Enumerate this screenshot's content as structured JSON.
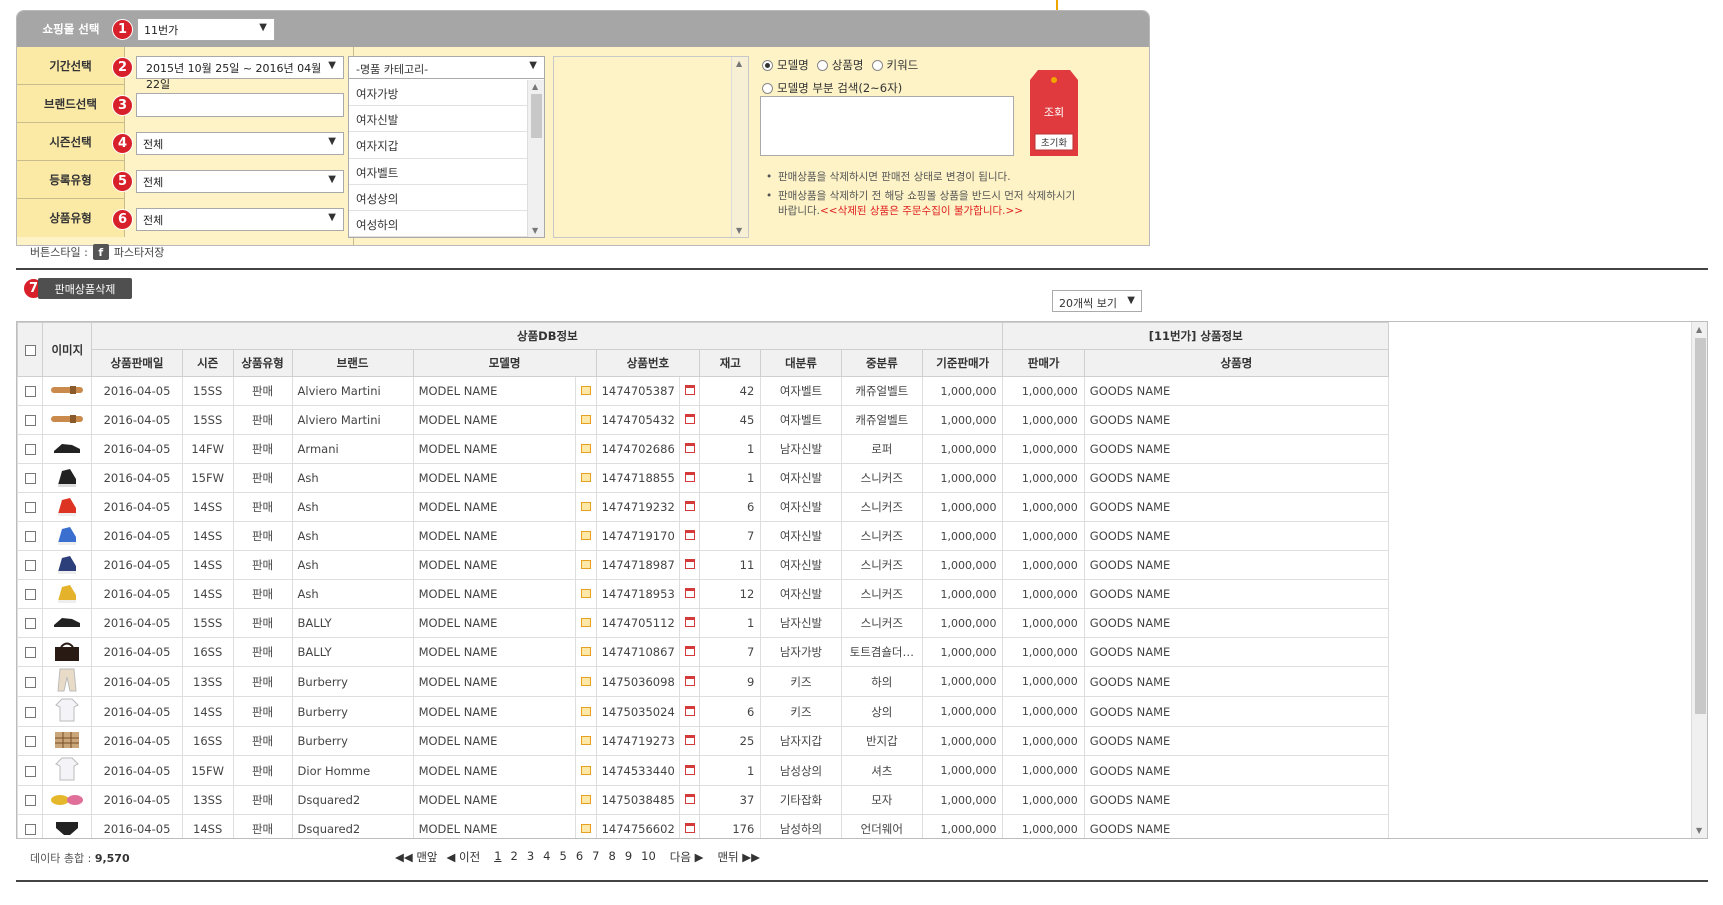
{
  "search": {
    "mall_label": "쇼핑몰 선택",
    "mall_value": "11번가",
    "period_label": "기간선택",
    "period_value": "2015년 10월 25일 ~ 2016년 04월 22일",
    "brand_label": "브랜드선택",
    "season_label": "시즌선택",
    "season_value": "전체",
    "reg_label": "등록유형",
    "reg_value": "전체",
    "ptype_label": "상품유형",
    "ptype_value": "전체",
    "category_select": "-명품 카테고리-",
    "categories": [
      "여자가방",
      "여자신발",
      "여자지갑",
      "여자벨트",
      "여성상의",
      "여성하의"
    ],
    "radio_model": "모델명",
    "radio_product": "상품명",
    "radio_keyword": "키워드",
    "radio_partial": "모델명 부분 검색(2~6자)",
    "note1": "판매상품을 삭제하시면 판매전 상태로 변경이 됩니다.",
    "note2a": "판매상품을 삭제하기 전 해당 쇼핑몰 상품을 반드시 먼저 삭제하시기",
    "note2b": "바랍니다.",
    "note2c": "<<삭제된 상품은 주문수집이 불가합니다.>>",
    "search_btn": "조회",
    "reset_btn": "초기화",
    "badges": [
      "1",
      "2",
      "3",
      "4",
      "5",
      "6",
      "7"
    ]
  },
  "toolbar": {
    "button_style_label": "버튼스타일 :",
    "fb_icon": "f",
    "fb_label": "파스타저장",
    "delete_btn": "판매상품삭제",
    "view_select": "20개씩 보기"
  },
  "table": {
    "group_db": "상품DB정보",
    "group_11st": "[11번가] 상품정보",
    "col_image": "이미지",
    "columns": [
      "상품판매일",
      "시즌",
      "상품유형",
      "브랜드",
      "모델명",
      "상품번호",
      "재고",
      "대분류",
      "중분류",
      "기준판매가",
      "판매가",
      "상품명"
    ],
    "rows": [
      {
        "date": "2016-04-05",
        "season": "15SS",
        "type": "판매",
        "brand": "Alviero Martini",
        "model": "MODEL NAME",
        "no": "1474705387",
        "stock": "42",
        "cat1": "여자벨트",
        "cat2": "캐쥬얼벨트",
        "base": "1,000,000",
        "price": "1,000,000",
        "name": "GOODS NAME",
        "img": "belt-tan"
      },
      {
        "date": "2016-04-05",
        "season": "15SS",
        "type": "판매",
        "brand": "Alviero Martini",
        "model": "MODEL NAME",
        "no": "1474705432",
        "stock": "45",
        "cat1": "여자벨트",
        "cat2": "캐쥬얼벨트",
        "base": "1,000,000",
        "price": "1,000,000",
        "name": "GOODS NAME",
        "img": "belt-tan"
      },
      {
        "date": "2016-04-05",
        "season": "14FW",
        "type": "판매",
        "brand": "Armani",
        "model": "MODEL NAME",
        "no": "1474702686",
        "stock": "1",
        "cat1": "남자신발",
        "cat2": "로퍼",
        "base": "1,000,000",
        "price": "1,000,000",
        "name": "GOODS NAME",
        "img": "shoe-black"
      },
      {
        "date": "2016-04-05",
        "season": "15FW",
        "type": "판매",
        "brand": "Ash",
        "model": "MODEL NAME",
        "no": "1474718855",
        "stock": "1",
        "cat1": "여자신발",
        "cat2": "스니커즈",
        "base": "1,000,000",
        "price": "1,000,000",
        "name": "GOODS NAME",
        "img": "sneaker-black"
      },
      {
        "date": "2016-04-05",
        "season": "14SS",
        "type": "판매",
        "brand": "Ash",
        "model": "MODEL NAME",
        "no": "1474719232",
        "stock": "6",
        "cat1": "여자신발",
        "cat2": "스니커즈",
        "base": "1,000,000",
        "price": "1,000,000",
        "name": "GOODS NAME",
        "img": "sneaker-red"
      },
      {
        "date": "2016-04-05",
        "season": "14SS",
        "type": "판매",
        "brand": "Ash",
        "model": "MODEL NAME",
        "no": "1474719170",
        "stock": "7",
        "cat1": "여자신발",
        "cat2": "스니커즈",
        "base": "1,000,000",
        "price": "1,000,000",
        "name": "GOODS NAME",
        "img": "sneaker-blue"
      },
      {
        "date": "2016-04-05",
        "season": "14SS",
        "type": "판매",
        "brand": "Ash",
        "model": "MODEL NAME",
        "no": "1474718987",
        "stock": "11",
        "cat1": "여자신발",
        "cat2": "스니커즈",
        "base": "1,000,000",
        "price": "1,000,000",
        "name": "GOODS NAME",
        "img": "sneaker-navy"
      },
      {
        "date": "2016-04-05",
        "season": "14SS",
        "type": "판매",
        "brand": "Ash",
        "model": "MODEL NAME",
        "no": "1474718953",
        "stock": "12",
        "cat1": "여자신발",
        "cat2": "스니커즈",
        "base": "1,000,000",
        "price": "1,000,000",
        "name": "GOODS NAME",
        "img": "sneaker-yellow"
      },
      {
        "date": "2016-04-05",
        "season": "15SS",
        "type": "판매",
        "brand": "BALLY",
        "model": "MODEL NAME",
        "no": "1474705112",
        "stock": "1",
        "cat1": "남자신발",
        "cat2": "스니커즈",
        "base": "1,000,000",
        "price": "1,000,000",
        "name": "GOODS NAME",
        "img": "shoe-black"
      },
      {
        "date": "2016-04-05",
        "season": "16SS",
        "type": "판매",
        "brand": "BALLY",
        "model": "MODEL NAME",
        "no": "1474710867",
        "stock": "7",
        "cat1": "남자가방",
        "cat2": "토트겸숄더…",
        "base": "1,000,000",
        "price": "1,000,000",
        "name": "GOODS NAME",
        "img": "bag-black"
      },
      {
        "date": "2016-04-05",
        "season": "13SS",
        "type": "판매",
        "brand": "Burberry",
        "model": "MODEL NAME",
        "no": "1475036098",
        "stock": "9",
        "cat1": "키즈",
        "cat2": "하의",
        "base": "1,000,000",
        "price": "1,000,000",
        "name": "GOODS NAME",
        "img": "pants-beige"
      },
      {
        "date": "2016-04-05",
        "season": "14SS",
        "type": "판매",
        "brand": "Burberry",
        "model": "MODEL NAME",
        "no": "1475035024",
        "stock": "6",
        "cat1": "키즈",
        "cat2": "상의",
        "base": "1,000,000",
        "price": "1,000,000",
        "name": "GOODS NAME",
        "img": "shirt-white"
      },
      {
        "date": "2016-04-05",
        "season": "16SS",
        "type": "판매",
        "brand": "Burberry",
        "model": "MODEL NAME",
        "no": "1474719273",
        "stock": "25",
        "cat1": "남자지갑",
        "cat2": "반지갑",
        "base": "1,000,000",
        "price": "1,000,000",
        "name": "GOODS NAME",
        "img": "wallet-check"
      },
      {
        "date": "2016-04-05",
        "season": "15FW",
        "type": "판매",
        "brand": "Dior Homme",
        "model": "MODEL NAME",
        "no": "1474533440",
        "stock": "1",
        "cat1": "남성상의",
        "cat2": "셔츠",
        "base": "1,000,000",
        "price": "1,000,000",
        "name": "GOODS NAME",
        "img": "shirt-white"
      },
      {
        "date": "2016-04-05",
        "season": "13SS",
        "type": "판매",
        "brand": "Dsquared2",
        "model": "MODEL NAME",
        "no": "1475038485",
        "stock": "37",
        "cat1": "기타잡화",
        "cat2": "모자",
        "base": "1,000,000",
        "price": "1,000,000",
        "name": "GOODS NAME",
        "img": "cap-yellow"
      },
      {
        "date": "2016-04-05",
        "season": "14SS",
        "type": "판매",
        "brand": "Dsquared2",
        "model": "MODEL NAME",
        "no": "1474756602",
        "stock": "176",
        "cat1": "남성하의",
        "cat2": "언더웨어",
        "base": "1,000,000",
        "price": "1,000,000",
        "name": "GOODS NAME",
        "img": "underwear-black"
      }
    ]
  },
  "footer": {
    "total_label": "데이타 총합 :",
    "total_value": "9,570",
    "first": "◀◀ 맨앞",
    "prev": "◀ 이전",
    "pages": [
      "1",
      "2",
      "3",
      "4",
      "5",
      "6",
      "7",
      "8",
      "9",
      "10"
    ],
    "next": "다음 ▶",
    "last": "맨뒤 ▶▶"
  },
  "colors": {
    "panel_bg": "#fdf3c7",
    "header_gray": "#a6a6a6",
    "badge_red": "#d8202b",
    "tag_red": "#e03a3e",
    "accent_orange": "#f0a500"
  }
}
